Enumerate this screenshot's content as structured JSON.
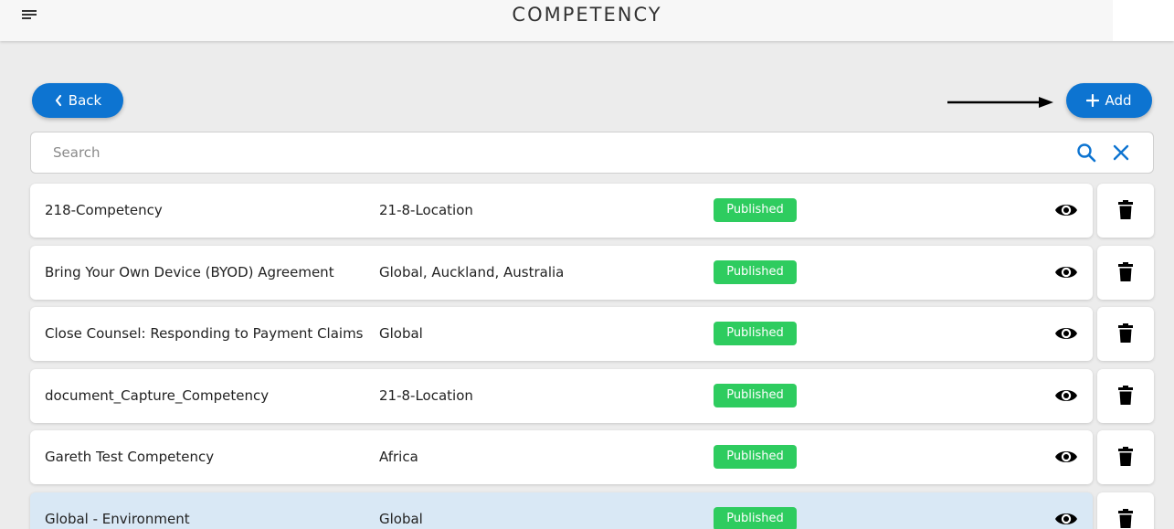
{
  "header": {
    "title": "COMPETENCY",
    "menu_icon": "hamburger-menu-icon"
  },
  "toolbar": {
    "back_label": "Back",
    "back_icon": "chevron-left-icon",
    "add_label": "Add",
    "add_icon": "plus-icon",
    "accent_color": "#0d74d1"
  },
  "search": {
    "placeholder": "Search",
    "value": "",
    "search_icon": "search-icon",
    "clear_icon": "close-icon"
  },
  "rows": [
    {
      "name": "218-Competency",
      "location": "21-8-Location",
      "status": "Published",
      "selected": false
    },
    {
      "name": "Bring Your Own Device (BYOD) Agreement",
      "location": "Global, Auckland, Australia",
      "status": "Published",
      "selected": false
    },
    {
      "name": "Close Counsel: Responding to Payment Claims",
      "location": "Global",
      "status": "Published",
      "selected": false
    },
    {
      "name": "document_Capture_Competency",
      "location": "21-8-Location",
      "status": "Published",
      "selected": false
    },
    {
      "name": "Gareth Test Competency",
      "location": "Africa",
      "status": "Published",
      "selected": false
    },
    {
      "name": "Global - Environment",
      "location": "Global",
      "status": "Published",
      "selected": true
    }
  ],
  "row_icons": {
    "view": "eye-icon",
    "delete": "trash-icon"
  },
  "colors": {
    "status_published": "#2ecc5f",
    "selected_row": "#d9e8f5"
  }
}
